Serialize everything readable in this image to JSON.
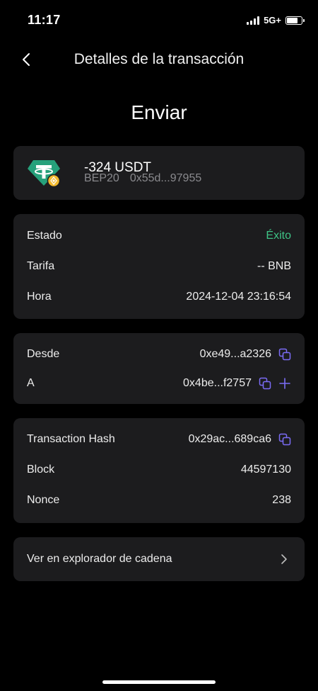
{
  "status_bar": {
    "time": "11:17",
    "network": "5G+"
  },
  "nav": {
    "title": "Detalles de la transacción"
  },
  "heading": "Enviar",
  "token": {
    "amount": "-324 USDT",
    "network": "BEP20",
    "address": "0x55d...97955"
  },
  "details": [
    {
      "label": "Estado",
      "value": "Éxito"
    },
    {
      "label": "Tarifa",
      "value": "-- BNB"
    },
    {
      "label": "Hora",
      "value": "2024-12-04 23:16:54"
    }
  ],
  "addresses": {
    "from_label": "Desde",
    "from_value": "0xe49...a2326",
    "to_label": "A",
    "to_value": "0x4be...f2757"
  },
  "chain": [
    {
      "label": "Transaction Hash",
      "value": "0x29ac...689ca6"
    },
    {
      "label": "Block",
      "value": "44597130"
    },
    {
      "label": "Nonce",
      "value": "238"
    }
  ],
  "explorer": {
    "label": "Ver en explorador de cadena"
  },
  "colors": {
    "success": "#3ec486",
    "accent": "#7b6cf6",
    "card": "#1c1c1e"
  }
}
